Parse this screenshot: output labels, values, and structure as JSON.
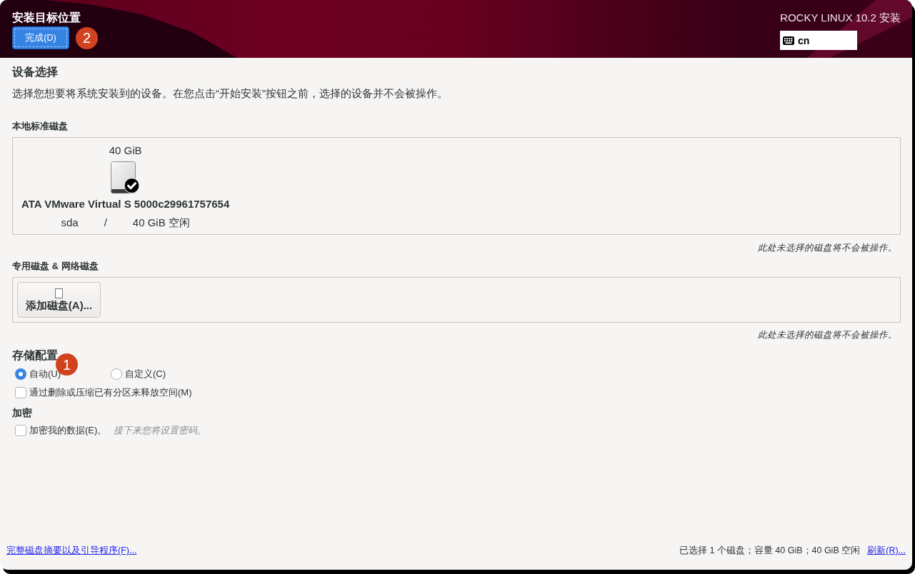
{
  "header": {
    "title": "安装目标位置",
    "done_button": {
      "label": "完成(D)",
      "callout": "2"
    },
    "product": "ROCKY LINUX 10.2 安装",
    "keyboard": {
      "value": "cn"
    }
  },
  "device_selection": {
    "title": "设备选择",
    "description": "选择您想要将系统安装到的设备。在您点击“开始安装”按钮之前，选择的设备并不会被操作。"
  },
  "local_disks": {
    "title": "本地标准磁盘",
    "disks": [
      {
        "size": "40 GiB",
        "selected": true,
        "name": "ATA VMware Virtual S 5000c29961757654",
        "device": "sda",
        "separator": "/",
        "free": "40 GiB 空闲"
      }
    ],
    "note": "此处未选择的磁盘将不会被操作。"
  },
  "specialized_disks": {
    "title": "专用磁盘 & 网络磁盘",
    "add_button": "添加磁盘(A)...",
    "note": "此处未选择的磁盘将不会被操作。"
  },
  "storage_config": {
    "title": "存储配置",
    "callout": "1",
    "options": [
      {
        "label": "自动(U)",
        "selected": true
      },
      {
        "label": "自定义(C)",
        "selected": false
      }
    ],
    "reclaim": {
      "label": "通过删除或压缩已有分区来释放空间(M)",
      "checked": false
    }
  },
  "encryption": {
    "title": "加密",
    "checkbox": {
      "label": "加密我的数据(E)。",
      "checked": false
    },
    "hint": "接下来您将设置密码。"
  },
  "footer": {
    "summary_link": "完整磁盘摘要以及引导程序(F)...",
    "status": "已选择 1 个磁盘；容量 40 GiB；40 GiB 空闲",
    "refresh_link": "刷新(R)..."
  }
}
